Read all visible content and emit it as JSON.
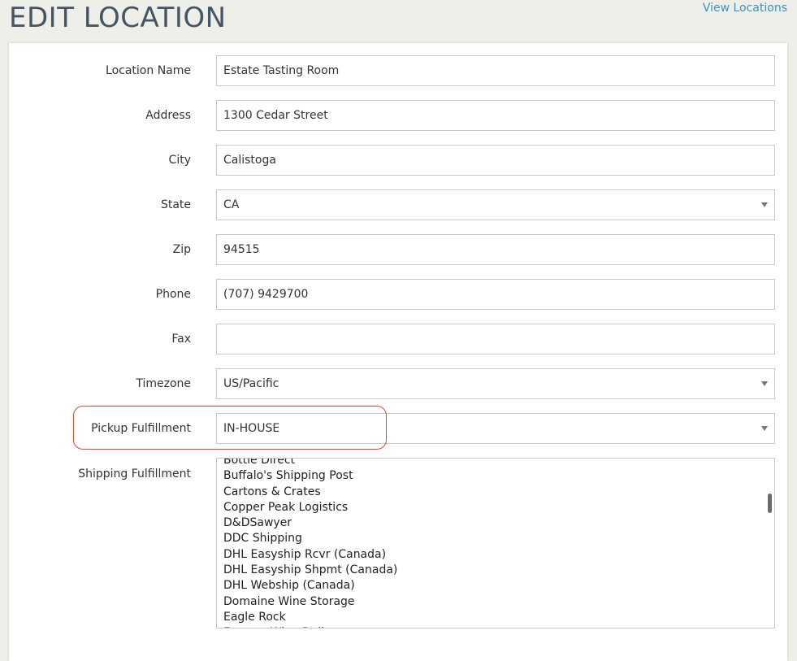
{
  "page": {
    "title": "EDIT LOCATION",
    "view_link": "View Locations"
  },
  "form": {
    "location_name": {
      "label": "Location Name",
      "value": "Estate Tasting Room"
    },
    "address": {
      "label": "Address",
      "value": "1300 Cedar Street"
    },
    "city": {
      "label": "City",
      "value": "Calistoga"
    },
    "state": {
      "label": "State",
      "value": "CA"
    },
    "zip": {
      "label": "Zip",
      "value": "94515"
    },
    "phone": {
      "label": "Phone",
      "value": "(707) 9429700"
    },
    "fax": {
      "label": "Fax",
      "value": ""
    },
    "timezone": {
      "label": "Timezone",
      "value": "US/Pacific"
    },
    "pickup_fulfillment": {
      "label": "Pickup Fulfillment",
      "value": "IN-HOUSE"
    },
    "shipping_fulfillment": {
      "label": "Shipping Fulfillment",
      "options": [
        "Bottle Direct",
        "Buffalo's Shipping Post",
        "Cartons & Crates",
        "Copper Peak Logistics",
        "D&DSawyer",
        "DDC Shipping",
        "DHL Easyship Rcvr (Canada)",
        "DHL Easyship Shpmt (Canada)",
        "DHL Webship (Canada)",
        "Domaine Wine Storage",
        "Eagle Rock",
        "Eastern Wine Delivery"
      ]
    }
  },
  "colors": {
    "title": "#465563",
    "link": "#3a93c5",
    "highlight": "#e0482a"
  }
}
